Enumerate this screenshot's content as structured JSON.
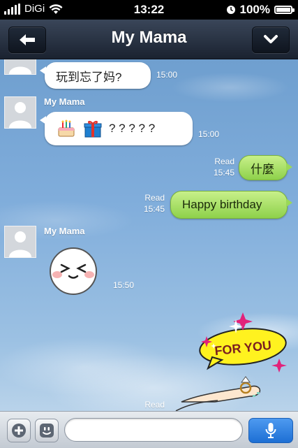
{
  "status_bar": {
    "carrier": "DiGi",
    "time": "13:22",
    "battery": "100%",
    "battery_level": 1.0
  },
  "nav": {
    "title": "My Mama",
    "back_icon": "arrow-left-icon",
    "menu_icon": "chevron-down-icon"
  },
  "messages": [
    {
      "direction": "in",
      "text": "玩到忘了妈?",
      "time": "15:00"
    },
    {
      "direction": "in",
      "sender": "My Mama",
      "text": "? ? ? ? ?",
      "stickers": [
        "cake-icon",
        "gift-icon"
      ],
      "time": "15:00"
    },
    {
      "direction": "out",
      "read": "Read",
      "time": "15:45",
      "text": "什麼"
    },
    {
      "direction": "out",
      "read": "Read",
      "time": "15:45",
      "text": "Happy birthday"
    },
    {
      "direction": "in",
      "sender": "My Mama",
      "sticker": "laughing-face-sticker",
      "time": "15:50"
    },
    {
      "direction": "out",
      "read": "Read",
      "sticker": "for-you-ring-sticker",
      "sticker_text": "FOR YOU"
    }
  ],
  "input_bar": {
    "add_icon": "plus-icon",
    "emoji_icon": "smiley-icon",
    "placeholder": "",
    "mic_icon": "microphone-icon"
  },
  "colors": {
    "nav_bg": "#1f2836",
    "bubble_out": "#a6e063",
    "bubble_in": "#ffffff",
    "sky": "#80addb",
    "mic": "#2a7ee0"
  }
}
